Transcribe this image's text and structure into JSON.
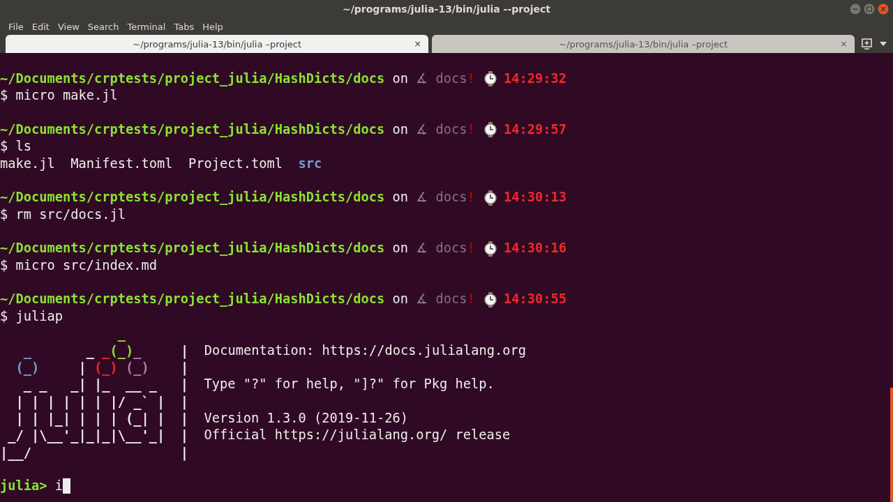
{
  "window": {
    "title": "~/programs/julia-13/bin/julia --project"
  },
  "menu": [
    "File",
    "Edit",
    "View",
    "Search",
    "Terminal",
    "Tabs",
    "Help"
  ],
  "tabs": [
    {
      "label": "~/programs/julia-13/bin/julia –project",
      "selected": true,
      "close": "×"
    },
    {
      "label": "~/programs/julia-13/bin/julia –project",
      "selected": false,
      "close": "×"
    }
  ],
  "terminal": {
    "lines": [
      {
        "kind": "prompt",
        "path": "~/Documents/crptests/project_julia/HashDicts/docs",
        "on": "on",
        "branch_symbol": "∡",
        "branch": "docs",
        "dirty": "!",
        "time": "14:29:32"
      },
      {
        "kind": "command",
        "symbol": "$",
        "text": "micro make.jl"
      },
      {
        "kind": "blank"
      },
      {
        "kind": "prompt",
        "path": "~/Documents/crptests/project_julia/HashDicts/docs",
        "on": "on",
        "branch_symbol": "∡",
        "branch": "docs",
        "dirty": "!",
        "time": "14:29:57"
      },
      {
        "kind": "command",
        "symbol": "$",
        "text": "ls"
      },
      {
        "kind": "listing",
        "items": [
          {
            "name": "make.jl",
            "kind": "file"
          },
          {
            "name": "Manifest.toml",
            "kind": "file"
          },
          {
            "name": "Project.toml",
            "kind": "file"
          },
          {
            "name": "src",
            "kind": "dir"
          }
        ]
      },
      {
        "kind": "blank"
      },
      {
        "kind": "prompt",
        "path": "~/Documents/crptests/project_julia/HashDicts/docs",
        "on": "on",
        "branch_symbol": "∡",
        "branch": "docs",
        "dirty": "!",
        "time": "14:30:13"
      },
      {
        "kind": "command",
        "symbol": "$",
        "text": "rm src/docs.jl"
      },
      {
        "kind": "blank"
      },
      {
        "kind": "prompt",
        "path": "~/Documents/crptests/project_julia/HashDicts/docs",
        "on": "on",
        "branch_symbol": "∡",
        "branch": "docs",
        "dirty": "!",
        "time": "14:30:16"
      },
      {
        "kind": "command",
        "symbol": "$",
        "text": "micro src/index.md"
      },
      {
        "kind": "blank"
      },
      {
        "kind": "prompt",
        "path": "~/Documents/crptests/project_julia/HashDicts/docs",
        "on": "on",
        "branch_symbol": "∡",
        "branch": "docs",
        "dirty": "!",
        "time": "14:30:55"
      },
      {
        "kind": "command",
        "symbol": "$",
        "text": "juliap"
      },
      {
        "kind": "banner",
        "art": [
          {
            "text": "               _",
            "color": "#8ae234"
          }
        ]
      },
      {
        "kind": "banner",
        "art": [
          {
            "text": "   _",
            "color": "#729fcf"
          },
          {
            "text": "       _ ",
            "color": "#eeeeec"
          },
          {
            "text": "_",
            "color": "#ef2929"
          },
          {
            "text": "(_)",
            "color": "#8ae234"
          },
          {
            "text": "_",
            "color": "#ad7fa8"
          },
          {
            "text": "     |",
            "color": "#eeeeec"
          }
        ],
        "info": "Documentation: https://docs.julialang.org"
      },
      {
        "kind": "banner",
        "art": [
          {
            "text": "  (_)",
            "color": "#729fcf"
          },
          {
            "text": "     | ",
            "color": "#eeeeec"
          },
          {
            "text": "(_)",
            "color": "#ef2929"
          },
          {
            "text": " (_)",
            "color": "#ad7fa8"
          },
          {
            "text": "    |",
            "color": "#eeeeec"
          }
        ]
      },
      {
        "kind": "banner",
        "art": [
          {
            "text": "   _ _   _| |_  __ _   |",
            "color": "#eeeeec"
          }
        ],
        "info": "Type \"?\" for help, \"]?\" for Pkg help."
      },
      {
        "kind": "banner",
        "art": [
          {
            "text": "  | | | | | | |/ _` |  |",
            "color": "#eeeeec"
          }
        ]
      },
      {
        "kind": "banner",
        "art": [
          {
            "text": "  | | |_| | | | (_| |  |",
            "color": "#eeeeec"
          }
        ],
        "info": "Version 1.3.0 (2019-11-26)"
      },
      {
        "kind": "banner",
        "art": [
          {
            "text": " _/ |\\__'_|_|_|\\__'_|  |",
            "color": "#eeeeec"
          }
        ],
        "info": "Official https://julialang.org/ release"
      },
      {
        "kind": "banner",
        "art": [
          {
            "text": "|__/                   |",
            "color": "#eeeeec"
          }
        ]
      },
      {
        "kind": "blank"
      },
      {
        "kind": "repl",
        "prompt": "julia>",
        "text": "i"
      }
    ]
  }
}
